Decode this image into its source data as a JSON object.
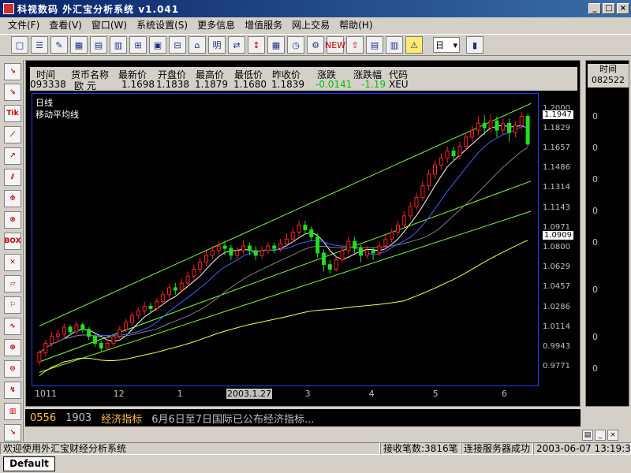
{
  "window": {
    "title": "科视数码  外汇宝分析系统 v1.041",
    "min": "_",
    "max": "□",
    "close": "×"
  },
  "menu": [
    "文件(F)",
    "查看(V)",
    "窗口(W)",
    "系统设置(S)",
    "更多信息",
    "增值服务",
    "网上交易",
    "帮助(H)"
  ],
  "toolbar": {
    "buttons": [
      "□",
      "☰",
      "✎",
      "▦",
      "▤",
      "▥",
      "⊞",
      "▣",
      "⊟",
      "⌂",
      "明",
      "⇄",
      "↕",
      "▦",
      "◷",
      "⚙",
      "NEW",
      "⇧",
      "▤",
      "▥",
      "⚠",
      "▮"
    ],
    "select_value": "日"
  },
  "leftbar": [
    "↘",
    "⇘",
    "Tik",
    "⟋",
    "↗",
    "⫽",
    "⟰",
    "⊗",
    "BOX",
    "✕",
    "▱",
    "⚐",
    "∿",
    "⊕",
    "⊖",
    "↯",
    "▥",
    "↘"
  ],
  "quote": {
    "headers": [
      "时间",
      "货币名称",
      "最新价",
      "开盘价",
      "最高价",
      "最低价",
      "昨收价",
      "涨跌",
      "涨跌幅",
      "代码"
    ],
    "values": [
      "093338",
      "欧  元",
      "1.1698",
      "1.1838",
      "1.1879",
      "1.1680",
      "1.1839",
      "-0.0141",
      "-1.19",
      "XEU"
    ],
    "colors": {
      "down": "#00c000",
      "normal": "#000000"
    }
  },
  "chart_data": {
    "type": "candlestick",
    "title": "日线",
    "subtitle": "移动平均线",
    "price_ticks": [
      "1.2000",
      "1.1829",
      "1.1657",
      "1.1486",
      "1.1314",
      "1.1143",
      "1.0971",
      "1.0800",
      "1.0629",
      "1.0457",
      "1.0286",
      "1.0114",
      "0.9943",
      "0.9771"
    ],
    "current_price_box": "1.1947",
    "cursor_price_box": "1.0909",
    "ylim": [
      0.965,
      1.21
    ],
    "time_ticks": [
      "1011",
      "12",
      "1",
      "2003.1.27",
      "3",
      "4",
      "5",
      "6"
    ],
    "highlight_tick": "2003.1.27",
    "series_colors": {
      "up": "#ff2020",
      "down": "#20e020",
      "ma_short": "#ffffff",
      "ma_mid": "#4060ff",
      "ma_long": "#808080",
      "ma_longest": "#ffff40",
      "channel": "#80ff40"
    },
    "candles": [
      [
        0.982,
        0.99,
        0.979,
        0.992
      ],
      [
        0.99,
        0.998,
        0.987,
        1.001
      ],
      [
        0.998,
        1.004,
        0.995,
        1.008
      ],
      [
        1.004,
        1.006,
        0.999,
        1.01
      ],
      [
        1.006,
        1.012,
        1.003,
        1.015
      ],
      [
        1.012,
        1.008,
        1.005,
        1.014
      ],
      [
        1.008,
        1.014,
        1.006,
        1.017
      ],
      [
        1.014,
        1.01,
        1.007,
        1.016
      ],
      [
        1.01,
        1.004,
        1.001,
        1.012
      ],
      [
        1.004,
        0.998,
        0.995,
        1.006
      ],
      [
        0.998,
        0.994,
        0.991,
        1.0
      ],
      [
        0.994,
        0.998,
        0.992,
        1.001
      ],
      [
        0.998,
        1.004,
        0.996,
        1.006
      ],
      [
        1.004,
        1.01,
        1.002,
        1.013
      ],
      [
        1.01,
        1.016,
        1.008,
        1.019
      ],
      [
        1.016,
        1.022,
        1.013,
        1.025
      ],
      [
        1.022,
        1.026,
        1.019,
        1.029
      ],
      [
        1.026,
        1.03,
        1.023,
        1.034
      ],
      [
        1.03,
        1.028,
        1.024,
        1.033
      ],
      [
        1.028,
        1.034,
        1.026,
        1.037
      ],
      [
        1.034,
        1.04,
        1.031,
        1.043
      ],
      [
        1.04,
        1.046,
        1.037,
        1.049
      ],
      [
        1.046,
        1.044,
        1.04,
        1.05
      ],
      [
        1.044,
        1.05,
        1.042,
        1.054
      ],
      [
        1.05,
        1.056,
        1.048,
        1.06
      ],
      [
        1.056,
        1.062,
        1.053,
        1.066
      ],
      [
        1.062,
        1.068,
        1.059,
        1.072
      ],
      [
        1.068,
        1.074,
        1.065,
        1.078
      ],
      [
        1.074,
        1.078,
        1.071,
        1.082
      ],
      [
        1.078,
        1.082,
        1.075,
        1.086
      ],
      [
        1.082,
        1.08,
        1.074,
        1.086
      ],
      [
        1.08,
        1.074,
        1.07,
        1.083
      ],
      [
        1.074,
        1.078,
        1.071,
        1.081
      ],
      [
        1.078,
        1.082,
        1.075,
        1.087
      ],
      [
        1.082,
        1.078,
        1.074,
        1.085
      ],
      [
        1.078,
        1.074,
        1.07,
        1.082
      ],
      [
        1.074,
        1.078,
        1.071,
        1.082
      ],
      [
        1.078,
        1.082,
        1.075,
        1.085
      ],
      [
        1.082,
        1.08,
        1.076,
        1.085
      ],
      [
        1.08,
        1.084,
        1.077,
        1.088
      ],
      [
        1.084,
        1.088,
        1.081,
        1.093
      ],
      [
        1.088,
        1.094,
        1.085,
        1.098
      ],
      [
        1.094,
        1.1,
        1.091,
        1.104
      ],
      [
        1.1,
        1.096,
        1.092,
        1.104
      ],
      [
        1.096,
        1.09,
        1.086,
        1.099
      ],
      [
        1.09,
        1.076,
        1.072,
        1.093
      ],
      [
        1.076,
        1.066,
        1.06,
        1.079
      ],
      [
        1.066,
        1.062,
        1.058,
        1.07
      ],
      [
        1.062,
        1.07,
        1.06,
        1.073
      ],
      [
        1.07,
        1.078,
        1.068,
        1.082
      ],
      [
        1.078,
        1.086,
        1.075,
        1.09
      ],
      [
        1.086,
        1.08,
        1.076,
        1.09
      ],
      [
        1.08,
        1.074,
        1.068,
        1.083
      ],
      [
        1.074,
        1.078,
        1.071,
        1.082
      ],
      [
        1.078,
        1.076,
        1.07,
        1.081
      ],
      [
        1.076,
        1.082,
        1.073,
        1.086
      ],
      [
        1.082,
        1.088,
        1.079,
        1.092
      ],
      [
        1.088,
        1.094,
        1.085,
        1.097
      ],
      [
        1.094,
        1.1,
        1.091,
        1.104
      ],
      [
        1.1,
        1.108,
        1.097,
        1.112
      ],
      [
        1.108,
        1.116,
        1.105,
        1.12
      ],
      [
        1.116,
        1.124,
        1.113,
        1.128
      ],
      [
        1.124,
        1.134,
        1.121,
        1.138
      ],
      [
        1.134,
        1.144,
        1.13,
        1.148
      ],
      [
        1.144,
        1.152,
        1.14,
        1.156
      ],
      [
        1.152,
        1.158,
        1.148,
        1.162
      ],
      [
        1.158,
        1.164,
        1.154,
        1.168
      ],
      [
        1.164,
        1.16,
        1.155,
        1.168
      ],
      [
        1.16,
        1.168,
        1.157,
        1.172
      ],
      [
        1.168,
        1.176,
        1.164,
        1.18
      ],
      [
        1.176,
        1.182,
        1.172,
        1.186
      ],
      [
        1.182,
        1.188,
        1.178,
        1.194
      ],
      [
        1.188,
        1.184,
        1.178,
        1.195
      ],
      [
        1.184,
        1.19,
        1.18,
        1.196
      ],
      [
        1.19,
        1.182,
        1.176,
        1.194
      ],
      [
        1.182,
        1.188,
        1.178,
        1.192
      ],
      [
        1.188,
        1.18,
        1.172,
        1.192
      ],
      [
        1.18,
        1.186,
        1.176,
        1.19
      ],
      [
        1.186,
        1.194,
        1.182,
        1.198
      ],
      [
        1.194,
        1.17,
        1.168,
        1.196
      ]
    ]
  },
  "rightpanel": {
    "header_1": "时间",
    "header_2": "082522",
    "zeros": [
      "0",
      "0",
      "0",
      "0",
      "0",
      "0",
      "0",
      "0"
    ]
  },
  "news": {
    "code": "0556",
    "time": "1903",
    "category": "经济指标",
    "text": "6月6日至7日国际已公布经济指标..."
  },
  "status": {
    "welcome": "欢迎使用外汇宝财经分析系统",
    "count": "接收笔数:3816笔",
    "server": "连接服务器成功",
    "datetime": "2003-06-07 13:19:30"
  },
  "tab": {
    "label": "Default"
  }
}
